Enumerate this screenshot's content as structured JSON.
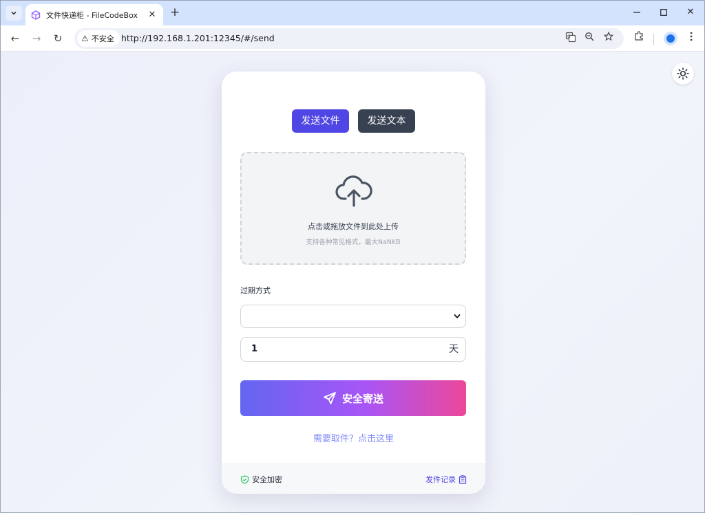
{
  "browser": {
    "tab": {
      "title": "文件快递柜 - FileCodeBox",
      "close": "✕"
    },
    "new_tab": "+",
    "window_controls": {
      "minimize": "—",
      "maximize": "☐",
      "close": "✕"
    },
    "nav": {
      "back": "←",
      "forward": "→",
      "reload": "↻"
    },
    "security_label": "不安全",
    "url": "http://192.168.1.201:12345/#/send",
    "icons": [
      "translate-icon",
      "zoom-icon",
      "star-icon",
      "extensions-icon",
      "profile-icon",
      "menu-icon"
    ]
  },
  "page": {
    "tabs": {
      "send_file": "发送文件",
      "send_text": "发送文本"
    },
    "dropzone": {
      "title": "点击或拖放文件到此处上传",
      "subtitle": "支持各种常见格式，最大NaNKB"
    },
    "expire": {
      "label": "过期方式",
      "select_value": "",
      "amount": "1",
      "unit": "天"
    },
    "send_button": "安全寄送",
    "retrieve_link": "需要取件？点击这里",
    "footer": {
      "secure": "安全加密",
      "history": "发件记录"
    },
    "colors": {
      "primary": "#4f46e5",
      "dark_button": "#374151",
      "gradient_start": "#6366f1",
      "gradient_end": "#ec4899",
      "secure_green": "#22c55e"
    }
  }
}
